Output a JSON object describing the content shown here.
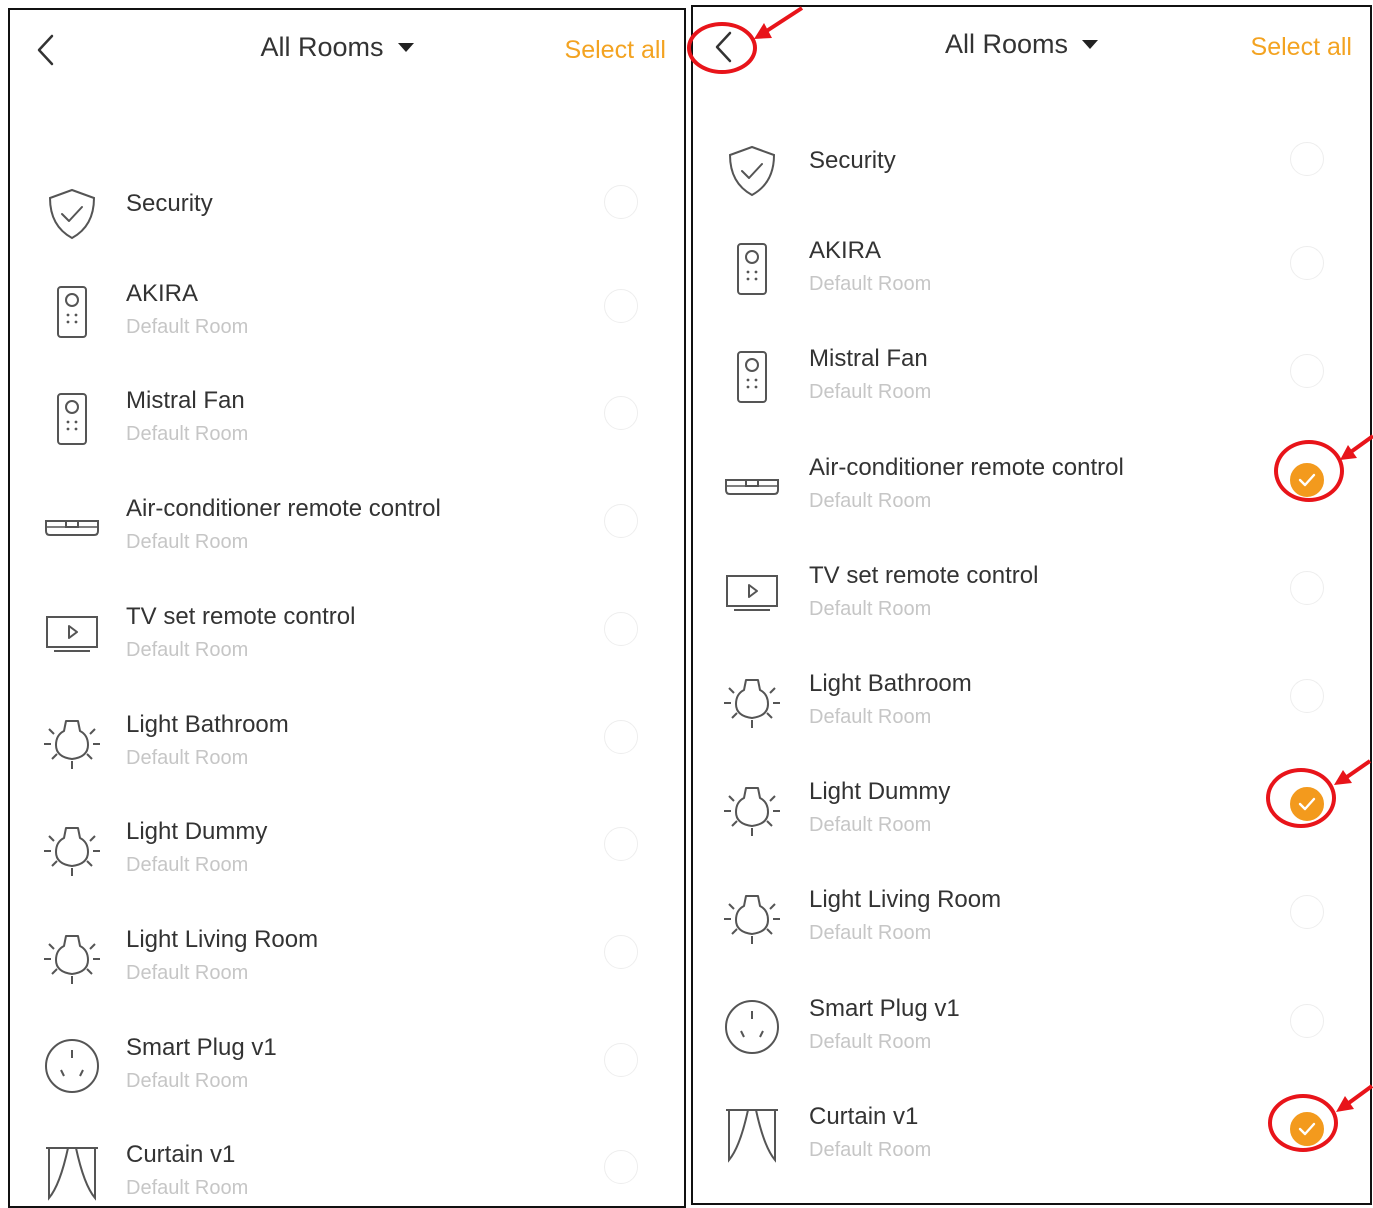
{
  "header": {
    "title": "All Rooms",
    "select_all": "Select all"
  },
  "left_panel": {
    "devices": [
      {
        "name": "Security",
        "room": "",
        "icon": "shield-icon",
        "selected": false
      },
      {
        "name": "AKIRA",
        "room": "Default Room",
        "icon": "remote-icon",
        "selected": false
      },
      {
        "name": "Mistral Fan",
        "room": "Default Room",
        "icon": "remote-icon",
        "selected": false
      },
      {
        "name": "Air-conditioner remote control",
        "room": "Default Room",
        "icon": "air-conditioner-icon",
        "selected": false
      },
      {
        "name": "TV set remote control",
        "room": "Default Room",
        "icon": "tv-icon",
        "selected": false
      },
      {
        "name": "Light Bathroom",
        "room": "Default Room",
        "icon": "light-bulb-icon",
        "selected": false
      },
      {
        "name": "Light Dummy",
        "room": "Default Room",
        "icon": "light-bulb-icon",
        "selected": false
      },
      {
        "name": "Light Living Room",
        "room": "Default Room",
        "icon": "light-bulb-icon",
        "selected": false
      },
      {
        "name": "Smart Plug v1",
        "room": "Default Room",
        "icon": "smart-plug-icon",
        "selected": false
      },
      {
        "name": "Curtain v1",
        "room": "Default Room",
        "icon": "curtain-icon",
        "selected": false
      }
    ]
  },
  "right_panel": {
    "devices": [
      {
        "name": "Security",
        "room": "",
        "icon": "shield-icon",
        "selected": false
      },
      {
        "name": "AKIRA",
        "room": "Default Room",
        "icon": "remote-icon",
        "selected": false
      },
      {
        "name": "Mistral Fan",
        "room": "Default Room",
        "icon": "remote-icon",
        "selected": false
      },
      {
        "name": "Air-conditioner remote control",
        "room": "Default Room",
        "icon": "air-conditioner-icon",
        "selected": true
      },
      {
        "name": "TV set remote control",
        "room": "Default Room",
        "icon": "tv-icon",
        "selected": false
      },
      {
        "name": "Light Bathroom",
        "room": "Default Room",
        "icon": "light-bulb-icon",
        "selected": false
      },
      {
        "name": "Light Dummy",
        "room": "Default Room",
        "icon": "light-bulb-icon",
        "selected": true
      },
      {
        "name": "Light Living Room",
        "room": "Default Room",
        "icon": "light-bulb-icon",
        "selected": false
      },
      {
        "name": "Smart Plug v1",
        "room": "Default Room",
        "icon": "smart-plug-icon",
        "selected": false
      },
      {
        "name": "Curtain v1",
        "room": "Default Room",
        "icon": "curtain-icon",
        "selected": true
      }
    ]
  },
  "colors": {
    "accent": "#f3a321",
    "check_fill": "#f39a1d",
    "annotation": "#e8141a",
    "border": "#111111"
  }
}
